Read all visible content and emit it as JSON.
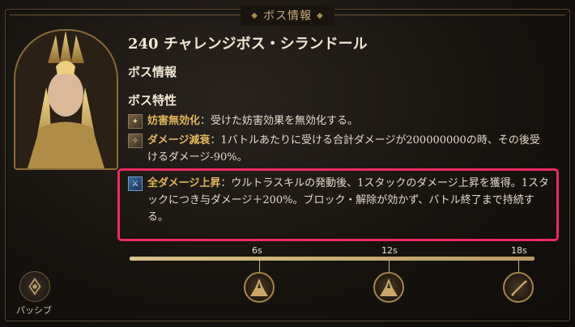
{
  "header": {
    "title": "ボス情報"
  },
  "boss": {
    "title": "240 チャレンジボス・シランドール"
  },
  "sections": {
    "info": "ボス情報",
    "traits": "ボス特性"
  },
  "traits": [
    {
      "icon": "status-immunity-icon",
      "name": "妨害無効化",
      "sep": "：",
      "desc": "受けた妨害効果を無効化する。"
    },
    {
      "icon": "damage-reduction-icon",
      "name": "ダメージ減衰",
      "sep": "：",
      "desc": "1バトルあたりに受ける合計ダメージが200000000の時、その後受けるダメージ-90%。"
    },
    {
      "icon": "damage-up-icon",
      "name": "全ダメージ上昇",
      "sep": "：",
      "desc": "ウルトラスキルの発動後、1スタックのダメージ上昇を獲得。1スタックにつき与ダメージ＋200%。ブロック・解除が効かず、バトル終了まで持続する。"
    }
  ],
  "timeline": {
    "ticks": [
      "6s",
      "12s",
      "18s"
    ]
  },
  "passive": {
    "label": "パッシブ"
  },
  "colors": {
    "accent": "#e1b65b",
    "highlight": "#ec2a63"
  }
}
